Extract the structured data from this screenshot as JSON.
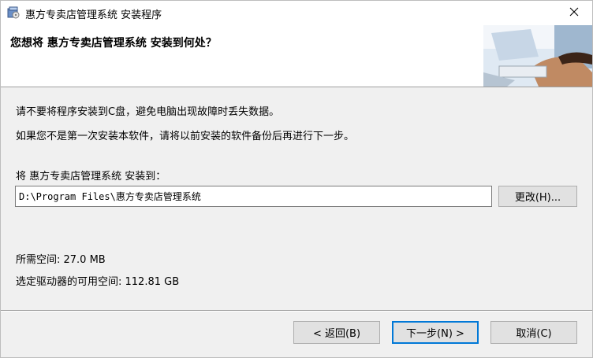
{
  "window": {
    "title": "惠方专卖店管理系统 安装程序",
    "close_icon": "close-icon",
    "app_icon": "installer-icon"
  },
  "header": {
    "title": "您想将 惠方专卖店管理系统 安装到何处？",
    "image": "installer-banner-image"
  },
  "body": {
    "notice_line1": "请不要将程序安装到C盘，避免电脑出现故障时丢失数据。",
    "notice_line2": "如果您不是第一次安装本软件，请将以前安装的软件备份后再进行下一步。",
    "install_to_label": "将 惠方专卖店管理系统 安装到：",
    "install_path": "D:\\Program Files\\惠方专卖店管理系统",
    "change_button": "更改(H)...",
    "required_space": "所需空间: 27.0 MB",
    "available_space": "选定驱动器的可用空间: 112.81 GB"
  },
  "footer": {
    "back_button": "< 返回(B)",
    "next_button": "下一步(N) >",
    "cancel_button": "取消(C)"
  },
  "colors": {
    "focus_border": "#0078d7",
    "dialog_bg": "#f0f0f0"
  }
}
